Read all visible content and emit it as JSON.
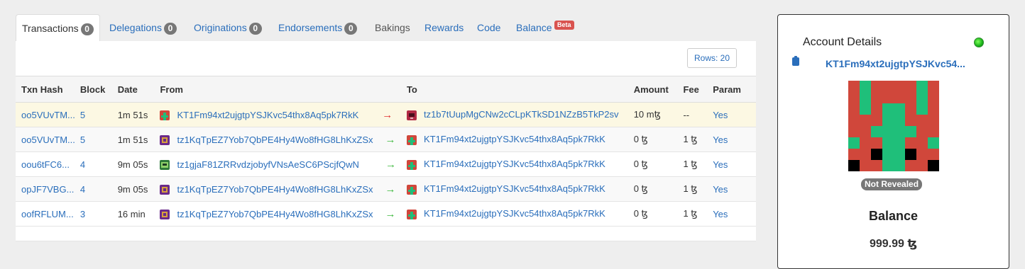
{
  "tabs": [
    {
      "label": "Transactions",
      "count": "0"
    },
    {
      "label": "Delegations",
      "count": "0"
    },
    {
      "label": "Originations",
      "count": "0"
    },
    {
      "label": "Endorsements",
      "count": "0"
    },
    {
      "label": "Bakings"
    },
    {
      "label": "Rewards"
    },
    {
      "label": "Code"
    },
    {
      "label": "Balance",
      "badge": "Beta"
    }
  ],
  "rows_button": "Rows: 20",
  "table": {
    "headers": [
      "Txn Hash",
      "Block",
      "Date",
      "From",
      "To",
      "Amount",
      "Fee",
      "Param"
    ],
    "rows": [
      {
        "hash": "oo5VUvTM...",
        "block": "5",
        "date": "1m 51s",
        "from": "KT1Fm94xt2ujgtpYSJKvc54thx8Aq5pk7RkK",
        "from_icon": "green-red-identicon",
        "direction": "out",
        "to": "tz1b7tUupMgCNw2cCLpKTkSD1NZzB5TkP2sv",
        "to_icon": "dark-red-identicon",
        "amount": "10 mꜩ",
        "fee": "--",
        "param": "Yes"
      },
      {
        "hash": "oo5VUvTM...",
        "block": "5",
        "date": "1m 51s",
        "from": "tz1KqTpEZ7Yob7QbPE4Hy4Wo8fHG8LhKxZSx",
        "from_icon": "purple-gold-identicon",
        "direction": "in",
        "to": "KT1Fm94xt2ujgtpYSJKvc54thx8Aq5pk7RkK",
        "to_icon": "green-red-identicon",
        "amount": "0 ꜩ",
        "fee": "1 ꜩ",
        "param": "Yes"
      },
      {
        "hash": "oou6tFC6...",
        "block": "4",
        "date": "9m 05s",
        "from": "tz1gjaF81ZRRvdzjobyfVNsAeSC6PScjfQwN",
        "from_icon": "green-dark-identicon",
        "direction": "in",
        "to": "KT1Fm94xt2ujgtpYSJKvc54thx8Aq5pk7RkK",
        "to_icon": "green-red-identicon",
        "amount": "0 ꜩ",
        "fee": "1 ꜩ",
        "param": "Yes"
      },
      {
        "hash": "opJF7VBG...",
        "block": "4",
        "date": "9m 05s",
        "from": "tz1KqTpEZ7Yob7QbPE4Hy4Wo8fHG8LhKxZSx",
        "from_icon": "purple-gold-identicon",
        "direction": "in",
        "to": "KT1Fm94xt2ujgtpYSJKvc54thx8Aq5pk7RkK",
        "to_icon": "green-red-identicon",
        "amount": "0 ꜩ",
        "fee": "1 ꜩ",
        "param": "Yes"
      },
      {
        "hash": "oofRFLUM...",
        "block": "3",
        "date": "16 min",
        "from": "tz1KqTpEZ7Yob7QbPE4Hy4Wo8fHG8LhKxZSx",
        "from_icon": "purple-gold-identicon",
        "direction": "in",
        "to": "KT1Fm94xt2ujgtpYSJKvc54thx8Aq5pk7RkK",
        "to_icon": "green-red-identicon",
        "amount": "0 ꜩ",
        "fee": "1 ꜩ",
        "param": "Yes"
      }
    ]
  },
  "account": {
    "title": "Account Details",
    "status": "online",
    "address": "KT1Fm94xt2ujgtpYSJKvc54...",
    "reveal_status": "Not Revealed",
    "balance_label": "Balance",
    "balance_value": "999.99 ꜩ"
  },
  "colors": {
    "link": "#2a6ebb",
    "highlight_row": "#fcf8e3",
    "out_arrow": "#e03030",
    "in_arrow": "#3cb83c",
    "identicon_red": "#d0473b",
    "identicon_green": "#1fbf7a"
  }
}
